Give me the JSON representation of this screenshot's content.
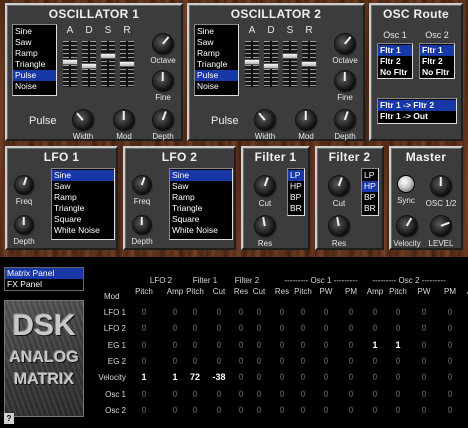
{
  "osc1": {
    "title": "OSCILLATOR 1",
    "waveforms": [
      "Sine",
      "Saw",
      "Ramp",
      "Triangle",
      "Pulse",
      "Noise"
    ],
    "selected": "Pulse",
    "adsr_labels": [
      "A",
      "D",
      "S",
      "R"
    ],
    "adsr_values": [
      0.55,
      0.45,
      0.7,
      0.5
    ],
    "mode_label": "Pulse",
    "knobs": {
      "octave": "Octave",
      "fine": "Fine",
      "width": "Width",
      "mod": "Mod",
      "depth": "Depth"
    }
  },
  "osc2": {
    "title": "OSCILLATOR 2",
    "waveforms": [
      "Sine",
      "Saw",
      "Ramp",
      "Triangle",
      "Pulse",
      "Noise"
    ],
    "selected": "Pulse",
    "adsr_labels": [
      "A",
      "D",
      "S",
      "R"
    ],
    "adsr_values": [
      0.55,
      0.45,
      0.7,
      0.5
    ],
    "mode_label": "Pulse",
    "knobs": {
      "octave": "Octave",
      "fine": "Fine",
      "width": "Width",
      "mod": "Mod",
      "depth": "Depth"
    }
  },
  "osc_route": {
    "title": "OSC Route",
    "osc1_label": "Osc 1",
    "osc2_label": "Osc 2",
    "osc1_options": [
      "Fltr 1",
      "Fltr 2",
      "No Fltr"
    ],
    "osc1_selected": "Fltr 1",
    "osc2_options": [
      "Fltr 1",
      "Fltr 2",
      "No Fltr"
    ],
    "osc2_selected": "Fltr 1",
    "chain_options": [
      "Fltr 1 -> Fltr 2",
      "Fltr 1 -> Out"
    ],
    "chain_selected": "Fltr 1 -> Fltr 2"
  },
  "lfo1": {
    "title": "LFO 1",
    "waveforms": [
      "Sine",
      "Saw",
      "Ramp",
      "Triangle",
      "Square",
      "White Noise"
    ],
    "selected": "Sine",
    "knobs": {
      "freq": "Freq",
      "depth": "Depth"
    }
  },
  "lfo2": {
    "title": "LFO 2",
    "waveforms": [
      "Sine",
      "Saw",
      "Ramp",
      "Triangle",
      "Square",
      "White Noise"
    ],
    "selected": "Sine",
    "knobs": {
      "freq": "Freq",
      "depth": "Depth"
    }
  },
  "filter1": {
    "title": "Filter 1",
    "types": [
      "LP",
      "HP",
      "BP",
      "BR"
    ],
    "selected": "LP",
    "knobs": {
      "cut": "Cut",
      "res": "Res"
    }
  },
  "filter2": {
    "title": "Filter 2",
    "types": [
      "LP",
      "HP",
      "BP",
      "BR"
    ],
    "selected": "HP",
    "knobs": {
      "cut": "Cut",
      "res": "Res"
    }
  },
  "master": {
    "title": "Master",
    "sync": "Sync",
    "osc_mix": "OSC 1/2",
    "velocity": "Velocity",
    "level": "LEVEL"
  },
  "matrix": {
    "tabs": [
      "Matrix Panel",
      "FX Panel"
    ],
    "selected_tab": "Matrix Panel",
    "logo": [
      "DSK",
      "ANALOG",
      "MATRIX"
    ],
    "groups": [
      "LFO 2",
      "Filter 1",
      "Filter 2",
      "--------- Osc 1 ---------",
      "--------- Osc 2 ---------"
    ],
    "columns": [
      "Mod",
      "Pitch",
      "Amp",
      "Pitch",
      "Cut",
      "Res",
      "Cut",
      "Res",
      "Pitch",
      "PW",
      "PM",
      "Amp",
      "Pitch",
      "PW",
      "PM",
      "Amp"
    ],
    "rows": [
      {
        "label": "LFO 1",
        "values": [
          "0",
          "0",
          "0",
          "0",
          "0",
          "0",
          "0",
          "0",
          "0",
          "0",
          "0",
          "0",
          "0",
          "0",
          "0"
        ]
      },
      {
        "label": "LFO 2",
        "values": [
          "0",
          "0",
          "0",
          "0",
          "0",
          "0",
          "0",
          "0",
          "0",
          "0",
          "0",
          "0",
          "0",
          "0",
          "0"
        ]
      },
      {
        "label": "EG 1",
        "values": [
          "0",
          "0",
          "0",
          "0",
          "0",
          "0",
          "0",
          "0",
          "0",
          "0",
          "1",
          "1",
          "0",
          "0",
          "0"
        ]
      },
      {
        "label": "EG 2",
        "values": [
          "0",
          "0",
          "0",
          "0",
          "0",
          "0",
          "0",
          "0",
          "0",
          "0",
          "0",
          "0",
          "0",
          "0",
          "0"
        ]
      },
      {
        "label": "Velocity",
        "values": [
          "1",
          "1",
          "72",
          "-38",
          "0",
          "0",
          "0",
          "0",
          "0",
          "0",
          "0",
          "0",
          "0",
          "0",
          "0"
        ]
      },
      {
        "label": "Osc 1",
        "values": [
          "0",
          "0",
          "0",
          "0",
          "0",
          "0",
          "0",
          "0",
          "0",
          "0",
          "0",
          "0",
          "0",
          "0",
          "0"
        ]
      },
      {
        "label": "Osc 2",
        "values": [
          "0",
          "0",
          "0",
          "0",
          "0",
          "0",
          "0",
          "0",
          "0",
          "0",
          "0",
          "0",
          "0",
          "0",
          "0"
        ]
      }
    ],
    "help": "?"
  }
}
